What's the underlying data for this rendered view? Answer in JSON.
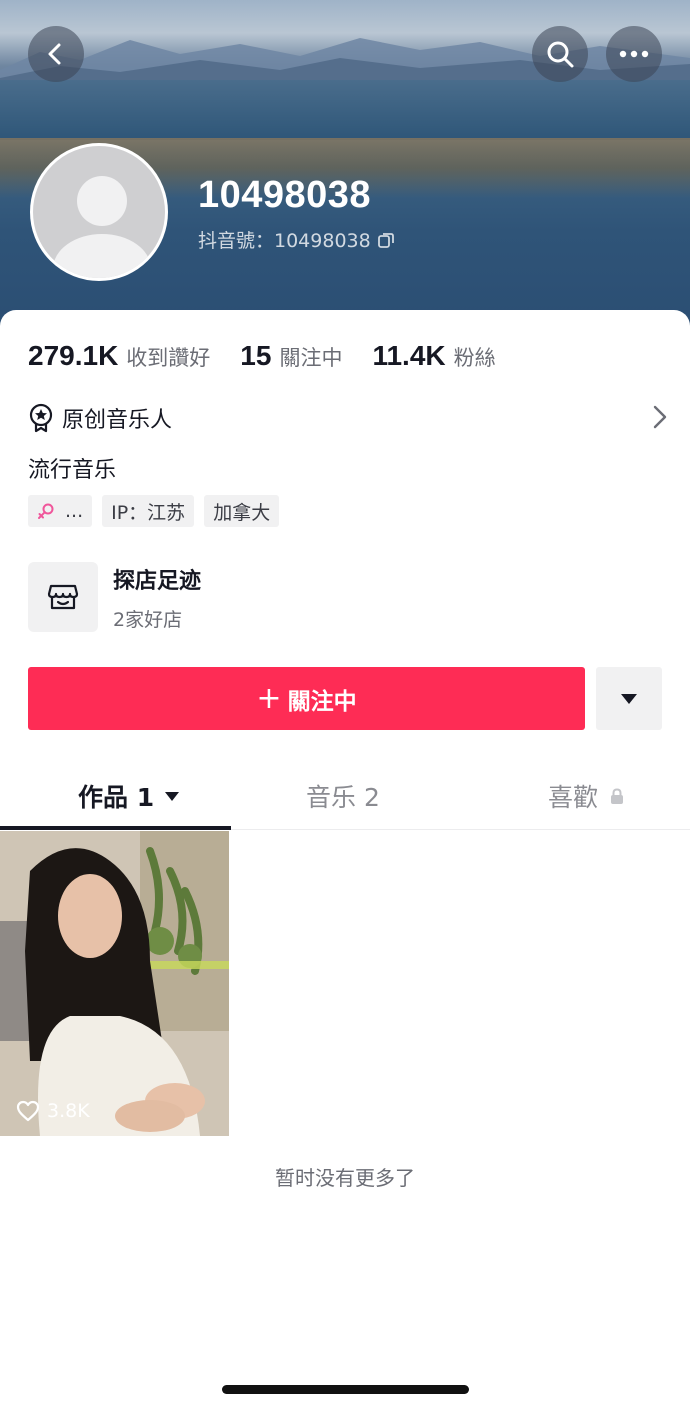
{
  "header": {
    "username": "10498038",
    "douyin_id": "抖音號：10498038"
  },
  "stats": [
    {
      "value": "279.1K",
      "label": "收到讚好"
    },
    {
      "value": "15",
      "label": "關注中"
    },
    {
      "value": "11.4K",
      "label": "粉絲"
    }
  ],
  "profile": {
    "creator_label": "原创音乐人",
    "bio": "流行音乐",
    "tags": {
      "gender_icon": "female-symbol-icon",
      "gender_extra": "...",
      "ip": "IP：江苏",
      "location": "加拿大"
    }
  },
  "shop": {
    "title": "探店足迹",
    "subtitle": "2家好店"
  },
  "actions": {
    "follow_label": "關注中",
    "follow_plus": "+"
  },
  "tabs": {
    "works": "作品 1",
    "music": "音乐 2",
    "likes": "喜歡"
  },
  "videos": [
    {
      "likes": "3.8K"
    }
  ],
  "footer": {
    "no_more": "暂时没有更多了"
  },
  "colors": {
    "accent": "#fe2c55",
    "text_primary": "#161823",
    "text_secondary": "#6b6d75"
  }
}
